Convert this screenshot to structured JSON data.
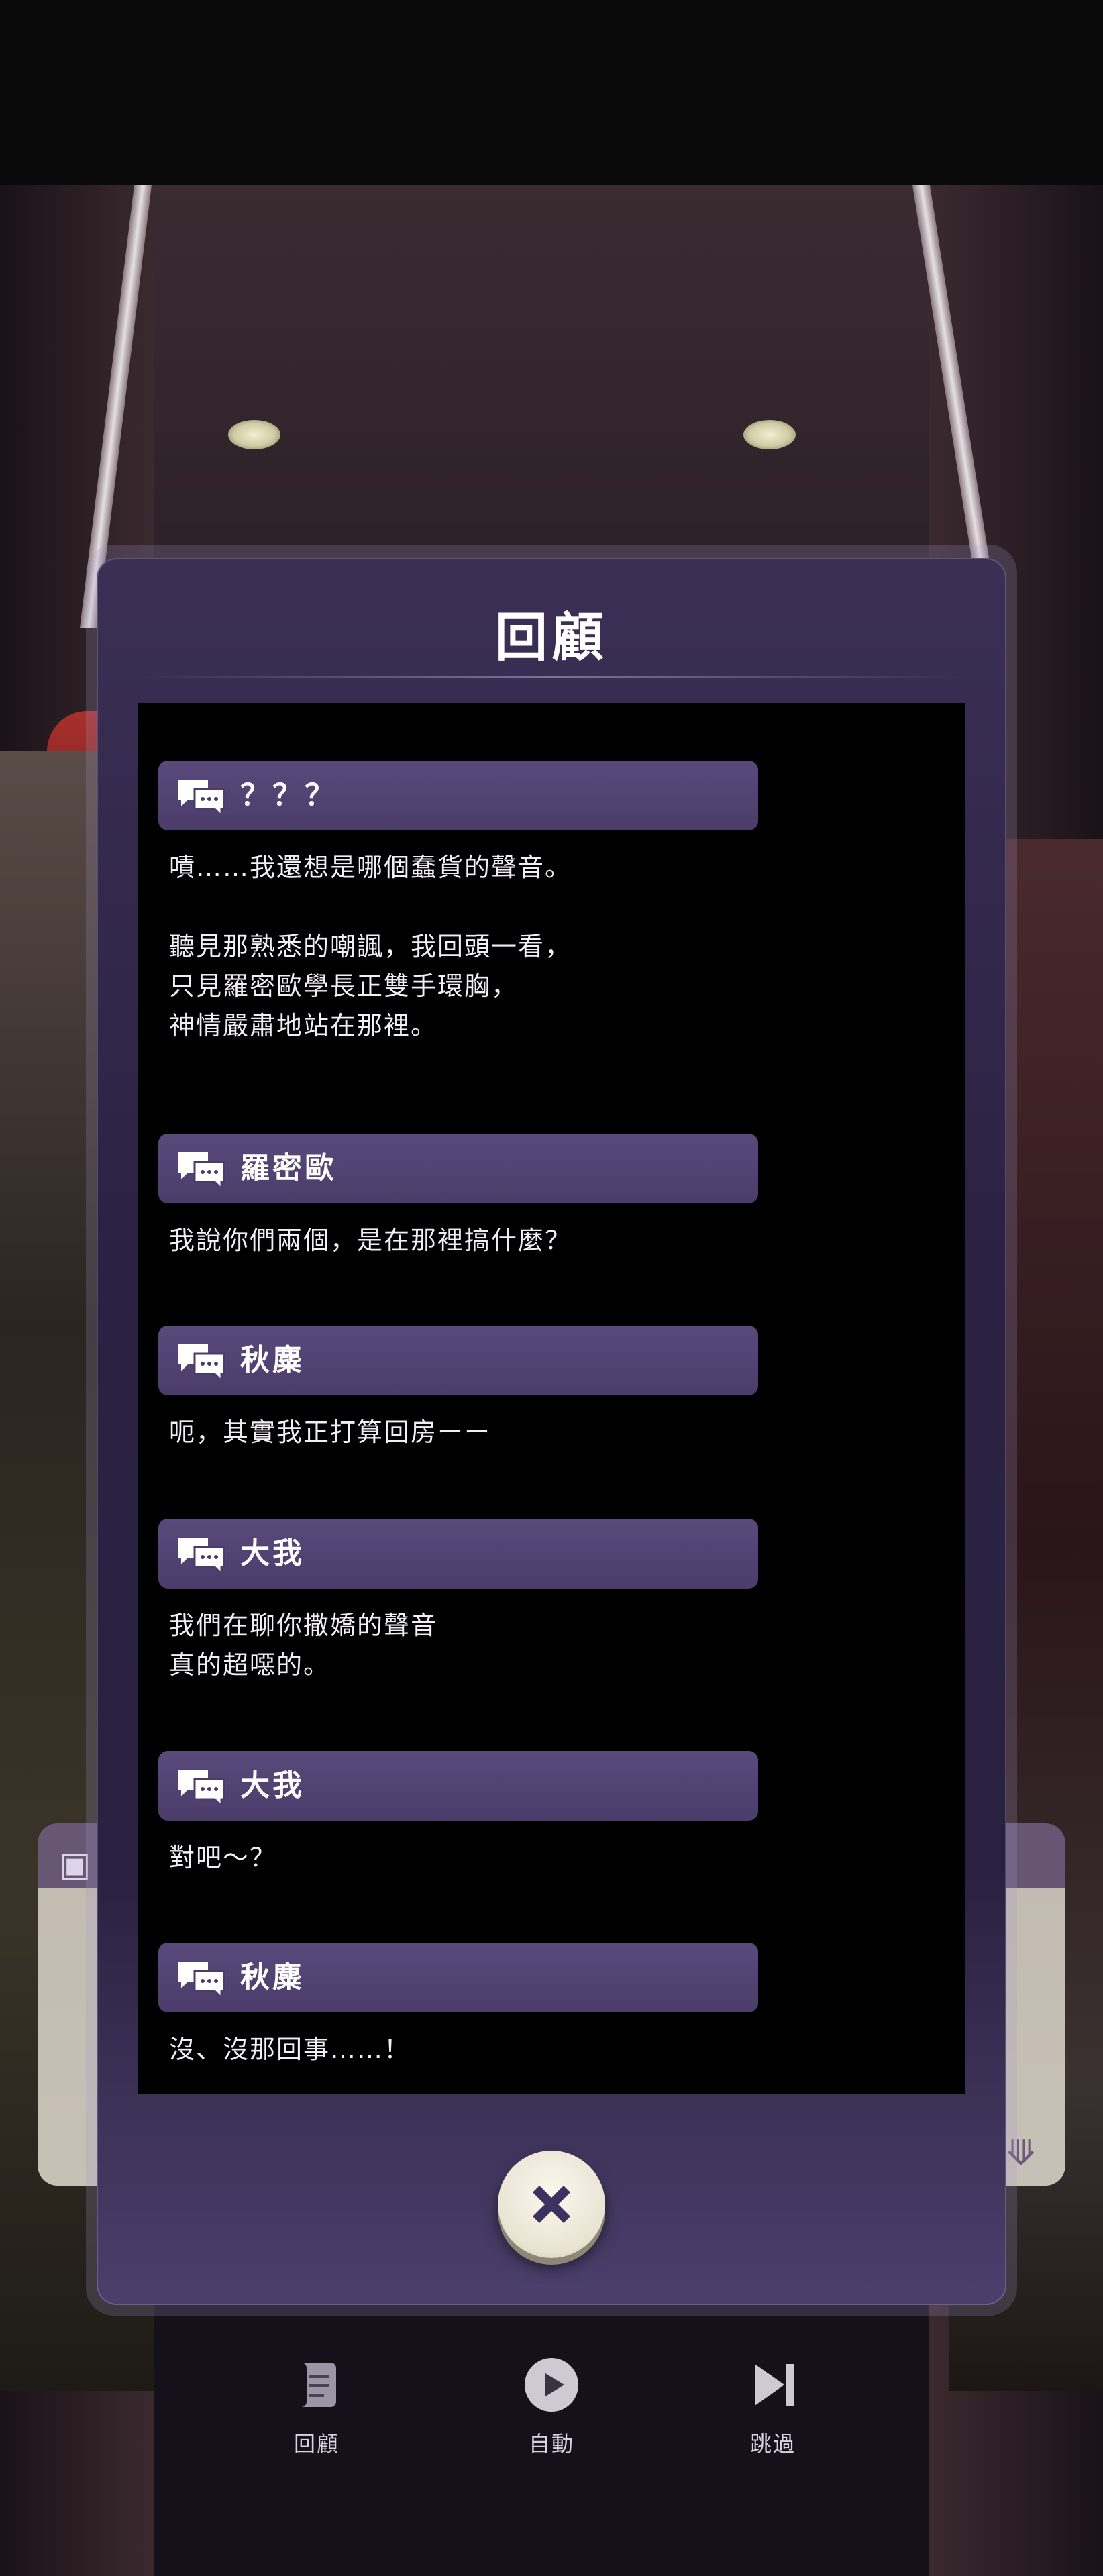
{
  "review": {
    "title": "回顧",
    "entries": [
      {
        "speaker": "？？？",
        "text": "嘖……我還想是哪個蠢貨的聲音。\n\n聽見那熟悉的嘲諷，我回頭一看，\n只見羅密歐學長正雙手環胸，\n神情嚴肅地站在那裡。"
      },
      {
        "speaker": "羅密歐",
        "text": "我說你們兩個，是在那裡搞什麼？"
      },
      {
        "speaker": "秋麋",
        "text": "呃，其實我正打算回房ーー"
      },
      {
        "speaker": "大我",
        "text": "我們在聊你撒嬌的聲音\n真的超噁的。"
      },
      {
        "speaker": "大我",
        "text": "對吧～？"
      },
      {
        "speaker": "秋麋",
        "text": "沒、沒那回事……！"
      }
    ],
    "close_icon": "close-icon"
  },
  "controls": [
    {
      "icon": "scroll-icon",
      "label": "回顧"
    },
    {
      "icon": "play-icon",
      "label": "自動"
    },
    {
      "icon": "skip-icon",
      "label": "跳過"
    }
  ],
  "colors": {
    "panel": "#2b2243",
    "name_bar": "#4b3c6a",
    "log_bg": "#000000",
    "text": "#f1eef5"
  }
}
